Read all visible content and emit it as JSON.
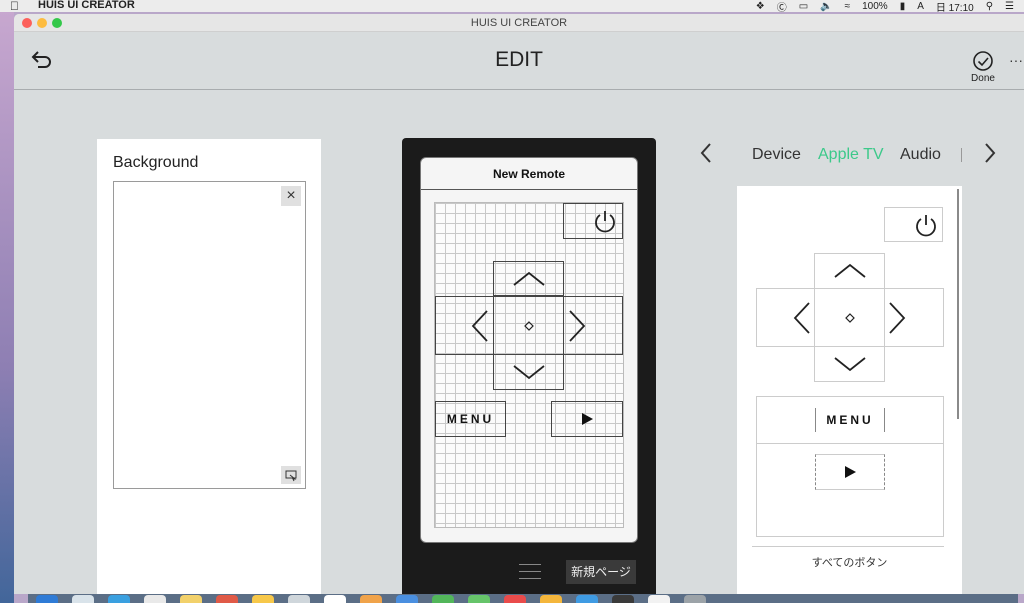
{
  "menubar": {
    "app_name": "HUIS UI CREATOR",
    "battery": "100%",
    "input": "A",
    "clock": "日 17:10"
  },
  "window": {
    "title": "HUIS UI CREATOR"
  },
  "toolbar": {
    "title": "EDIT",
    "done_label": "Done",
    "more_label": "···"
  },
  "background_panel": {
    "label": "Background",
    "close_label": "×"
  },
  "remote": {
    "title": "New Remote",
    "menu_label": "MENU",
    "new_page_label": "新規ページ"
  },
  "palette": {
    "tabs": [
      "Device",
      "Apple TV",
      "Audio"
    ],
    "active_tab": "Apple TV",
    "menu_label": "MENU",
    "footer_label": "すべてのボタン"
  },
  "colors": {
    "accent": "#3cc98a",
    "window_bg": "#d8dcdd",
    "phone_body": "#1b1b1b"
  }
}
